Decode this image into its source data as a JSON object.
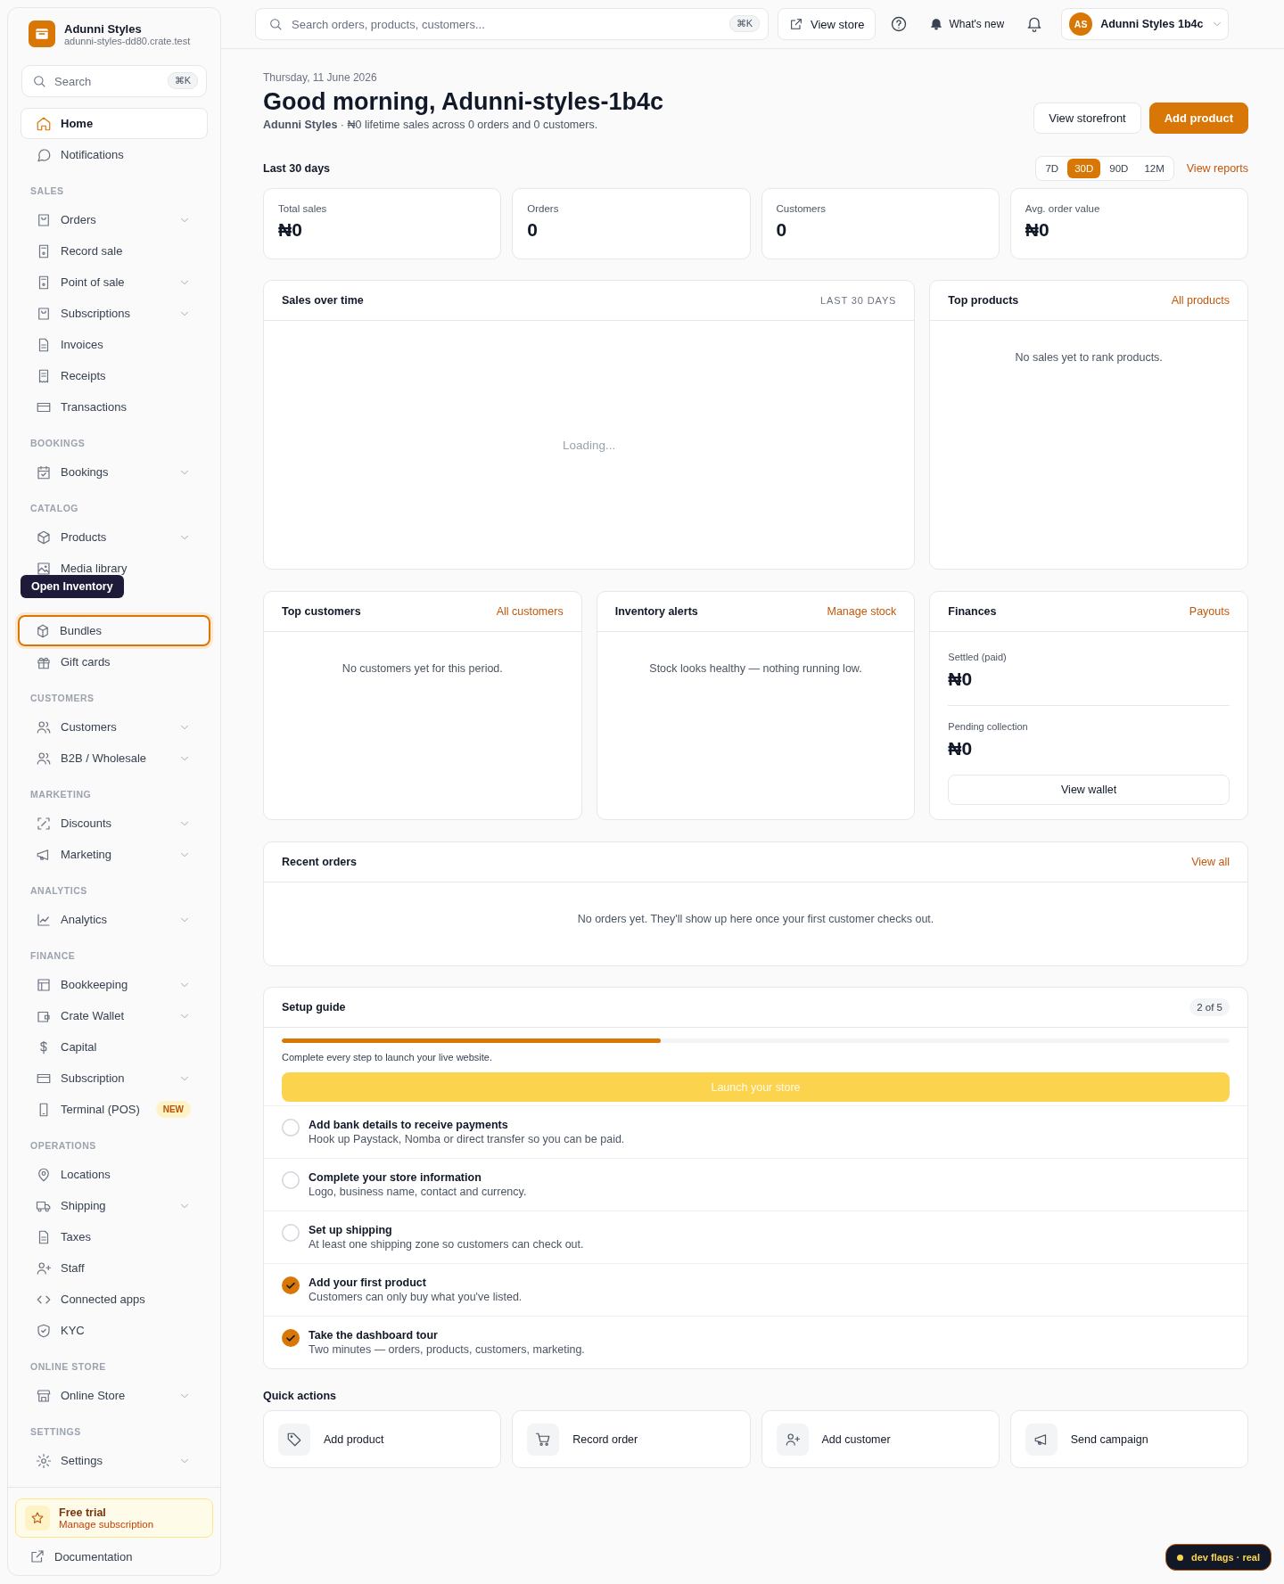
{
  "brand": {
    "name": "Adunni Styles",
    "domain": "adunni-styles-dd80.crate.test"
  },
  "sidebar_search": {
    "placeholder": "Search",
    "shortcut": "⌘K"
  },
  "sidebar": {
    "sections": [
      {
        "items": [
          {
            "label": "Home",
            "expandable": false,
            "selected": true,
            "highlighted": false
          },
          {
            "label": "Notifications",
            "expandable": false,
            "selected": false,
            "highlighted": false
          }
        ]
      },
      {
        "title": "SALES",
        "items": [
          {
            "label": "Orders",
            "expandable": true,
            "selected": false,
            "highlighted": false
          },
          {
            "label": "Record sale",
            "expandable": false,
            "selected": false,
            "highlighted": false
          },
          {
            "label": "Point of sale",
            "expandable": true,
            "selected": false,
            "highlighted": false
          },
          {
            "label": "Subscriptions",
            "expandable": true,
            "selected": false,
            "highlighted": false
          },
          {
            "label": "Invoices",
            "expandable": false,
            "selected": false,
            "highlighted": false
          },
          {
            "label": "Receipts",
            "expandable": false,
            "selected": false,
            "highlighted": false
          },
          {
            "label": "Transactions",
            "expandable": false,
            "selected": false,
            "highlighted": false
          }
        ]
      },
      {
        "title": "BOOKINGS",
        "items": [
          {
            "label": "Bookings",
            "expandable": true,
            "selected": false,
            "highlighted": false
          }
        ]
      },
      {
        "title": "CATALOG",
        "items": [
          {
            "label": "Products",
            "expandable": true,
            "selected": false,
            "highlighted": false
          },
          {
            "label": "Media library",
            "expandable": false,
            "selected": false,
            "highlighted": false
          },
          {
            "label": "Bundles",
            "expandable": false,
            "selected": false,
            "highlighted": true,
            "tooltip": "Open Inventory"
          },
          {
            "label": "Gift cards",
            "expandable": false,
            "selected": false,
            "highlighted": false
          }
        ]
      },
      {
        "title": "CUSTOMERS",
        "items": [
          {
            "label": "Customers",
            "expandable": true,
            "selected": false,
            "highlighted": false
          },
          {
            "label": "B2B / Wholesale",
            "expandable": true,
            "selected": false,
            "highlighted": false
          }
        ]
      },
      {
        "title": "MARKETING",
        "items": [
          {
            "label": "Discounts",
            "expandable": true,
            "selected": false,
            "highlighted": false
          },
          {
            "label": "Marketing",
            "expandable": true,
            "selected": false,
            "highlighted": false
          }
        ]
      },
      {
        "title": "ANALYTICS",
        "items": [
          {
            "label": "Analytics",
            "expandable": true,
            "selected": false,
            "highlighted": false
          }
        ]
      },
      {
        "title": "FINANCE",
        "items": [
          {
            "label": "Bookkeeping",
            "expandable": true,
            "selected": false,
            "highlighted": false
          },
          {
            "label": "Crate Wallet",
            "expandable": true,
            "selected": false,
            "highlighted": false
          },
          {
            "label": "Capital",
            "expandable": false,
            "selected": false,
            "highlighted": false
          },
          {
            "label": "Subscription",
            "expandable": true,
            "selected": false,
            "highlighted": false
          },
          {
            "label": "Terminal (POS)",
            "expandable": false,
            "selected": false,
            "highlighted": false,
            "badge": "NEW"
          }
        ]
      },
      {
        "title": "OPERATIONS",
        "items": [
          {
            "label": "Locations",
            "expandable": false,
            "selected": false,
            "highlighted": false
          },
          {
            "label": "Shipping",
            "expandable": true,
            "selected": false,
            "highlighted": false
          },
          {
            "label": "Taxes",
            "expandable": false,
            "selected": false,
            "highlighted": false
          },
          {
            "label": "Staff",
            "expandable": false,
            "selected": false,
            "highlighted": false
          },
          {
            "label": "Connected apps",
            "expandable": false,
            "selected": false,
            "highlighted": false
          },
          {
            "label": "KYC",
            "expandable": false,
            "selected": false,
            "highlighted": false
          }
        ]
      },
      {
        "title": "ONLINE STORE",
        "items": [
          {
            "label": "Online Store",
            "expandable": true,
            "selected": false,
            "highlighted": false
          }
        ]
      },
      {
        "title": "SETTINGS",
        "items": [
          {
            "label": "Settings",
            "expandable": true,
            "selected": false,
            "highlighted": false
          }
        ]
      }
    ]
  },
  "trial": {
    "title": "Free trial",
    "subtitle": "Manage subscription"
  },
  "documentation": "Documentation",
  "topbar": {
    "search_placeholder": "Search orders, products, customers...",
    "shortcut": "⌘K",
    "view_store": "View store",
    "whats_new": "What's new",
    "account": {
      "initials": "AS",
      "name": "Adunni Styles 1b4c"
    }
  },
  "greeting": {
    "date": "Thursday, 11 June 2026",
    "title": "Good morning, Adunni-styles-1b4c",
    "subtitle": "**Adunni Styles** · ₦0 lifetime sales across 0 orders and 0 customers.",
    "buttons": [
      "View storefront",
      "Add product"
    ]
  },
  "period": {
    "label": "Last 30 days",
    "options": [
      {
        "label": "7D",
        "selected": false
      },
      {
        "label": "30D",
        "selected": true
      },
      {
        "label": "90D",
        "selected": false
      },
      {
        "label": "12M",
        "selected": false
      }
    ],
    "link": "View reports"
  },
  "stats": [
    {
      "label": "Total sales",
      "value": "₦0"
    },
    {
      "label": "Orders",
      "value": "0"
    },
    {
      "label": "Customers",
      "value": "0"
    },
    {
      "label": "Avg. order value",
      "value": "₦0"
    }
  ],
  "sales_over_time": {
    "title": "Sales over time",
    "range": "LAST 30 DAYS",
    "status": "Loading..."
  },
  "top_products": {
    "title": "Top products",
    "link": "All products",
    "empty": "No sales yet to rank products."
  },
  "top_customers": {
    "title": "Top customers",
    "link": "All customers",
    "empty": "No customers yet for this period."
  },
  "inventory_alerts": {
    "title": "Inventory alerts",
    "link": "Manage stock",
    "empty": "Stock looks healthy — nothing running low."
  },
  "finances": {
    "title": "Finances",
    "link": "Payouts",
    "rows": [
      {
        "label": "Settled (paid)",
        "value": "₦0"
      },
      {
        "label": "Pending collection",
        "value": "₦0"
      }
    ],
    "button": "View wallet"
  },
  "recent_orders": {
    "title": "Recent orders",
    "link": "View all",
    "empty": "No orders yet. They'll show up here once your first customer checks out."
  },
  "setup_guide": {
    "title": "Setup guide",
    "count": "2 of 5",
    "level": 0.4,
    "note": "Complete every step to launch your live website.",
    "launch_button": {
      "label": "Launch your store",
      "disabled": true
    },
    "steps": [
      {
        "title": "Add bank details to receive payments",
        "description": "Hook up Paystack, Nomba or direct transfer so you can be paid.",
        "checked": false
      },
      {
        "title": "Complete your store information",
        "description": "Logo, business name, contact and currency.",
        "checked": false
      },
      {
        "title": "Set up shipping",
        "description": "At least one shipping zone so customers can check out.",
        "checked": false
      },
      {
        "title": "Add your first product",
        "description": "Customers can only buy what you've listed.",
        "checked": true
      },
      {
        "title": "Take the dashboard tour",
        "description": "Two minutes — orders, products, customers, marketing.",
        "checked": true
      }
    ]
  },
  "quick_actions": {
    "title": "Quick actions",
    "items": [
      {
        "label": "Add product"
      },
      {
        "label": "Record order"
      },
      {
        "label": "Add customer"
      },
      {
        "label": "Send campaign"
      }
    ]
  },
  "dev_flags": "dev flags · real"
}
